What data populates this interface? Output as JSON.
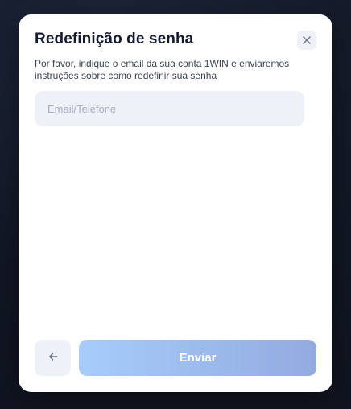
{
  "modal": {
    "title": "Redefinição de senha",
    "description": "Por favor, indique o email da sua conta 1WIN e enviaremos instruções sobre como redefinir sua senha",
    "close_icon": "close-icon"
  },
  "form": {
    "input_value": "",
    "input_placeholder": "Email/Telefone"
  },
  "actions": {
    "back_icon": "arrow-left-icon",
    "submit_label": "Enviar"
  },
  "colors": {
    "backdrop": "#121826",
    "modal_bg": "#ffffff",
    "title": "#151a2e",
    "field_bg": "#eef1f7",
    "submit_gradient_start": "#a6cdfb",
    "submit_gradient_end": "#93aae0"
  }
}
